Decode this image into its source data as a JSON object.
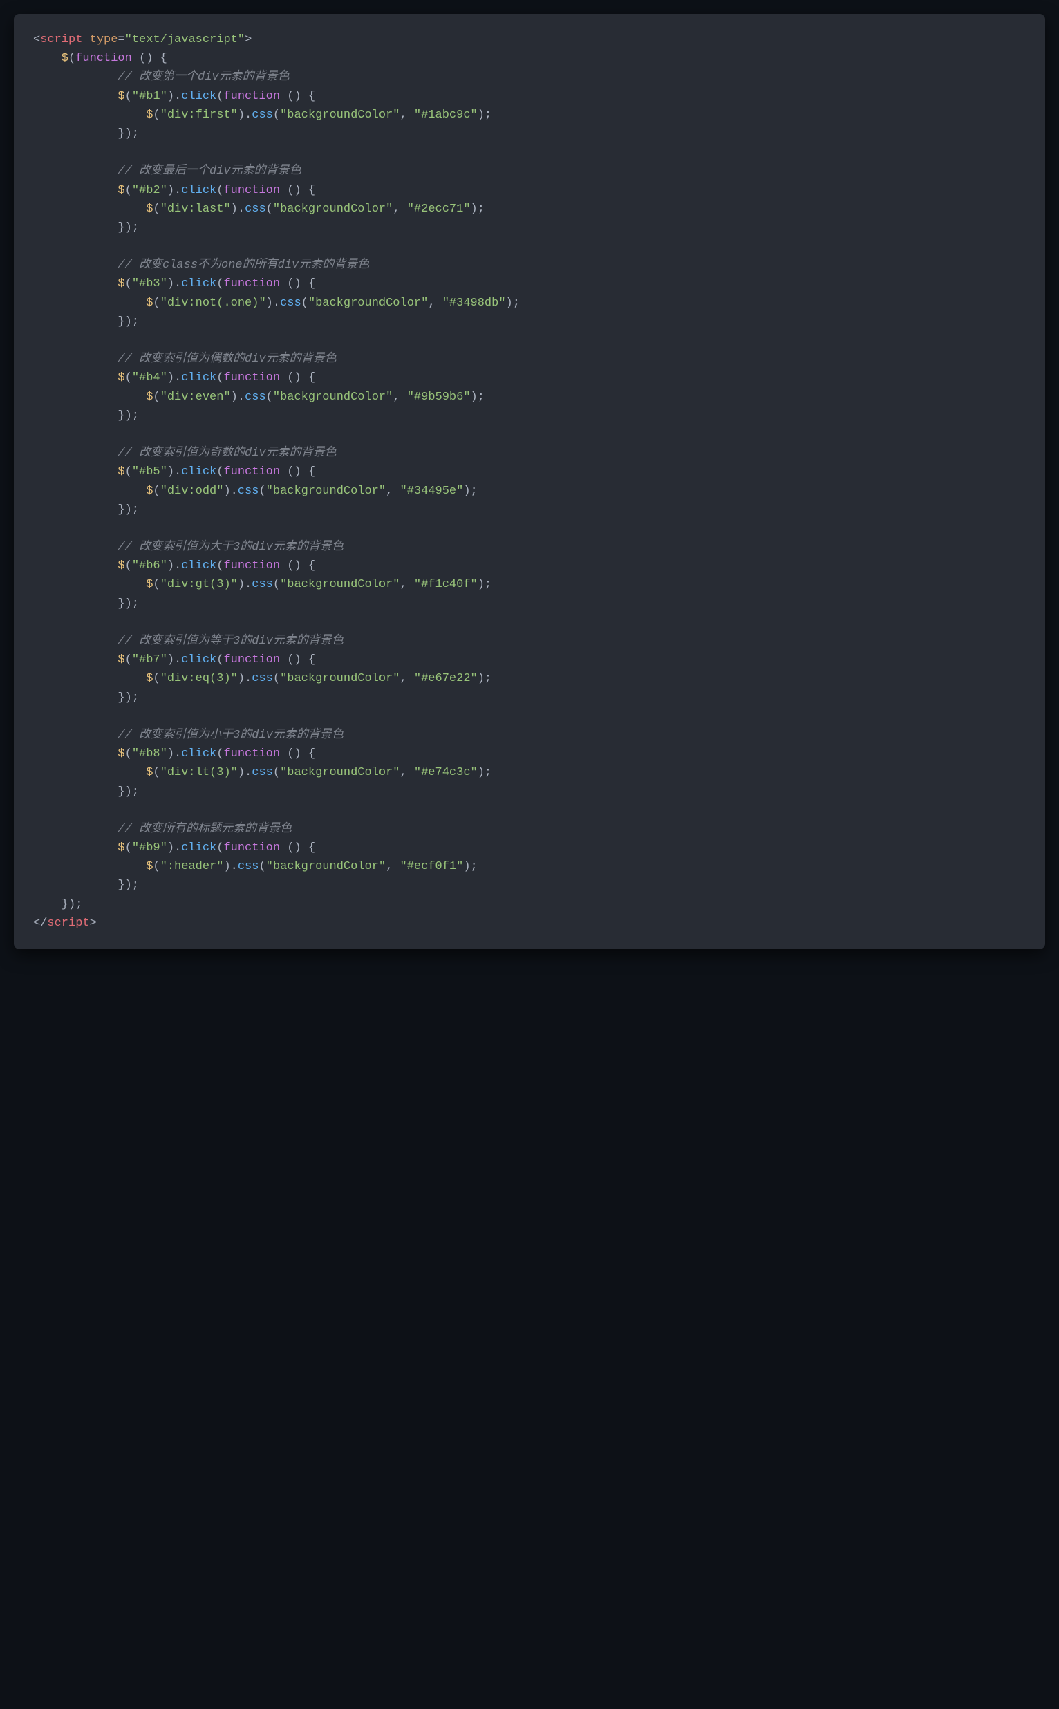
{
  "code": {
    "open_tag": {
      "lt": "<",
      "name": "script",
      "attr": "type",
      "eq": "=",
      "val": "\"text/javascript\"",
      "gt": ">"
    },
    "fn_open": {
      "dollar": "$",
      "lp": "(",
      "kw": "function",
      "sp": " ",
      "lp2": "(",
      "rp2": ")",
      "sp2": " ",
      "lb": "{"
    },
    "blocks": [
      {
        "comment": "// 改变第一个div元素的背景色",
        "id": "\"#b1\"",
        "sel": "\"div:first\"",
        "color": "\"#1abc9c\""
      },
      {
        "comment": "// 改变最后一个div元素的背景色",
        "id": "\"#b2\"",
        "sel": "\"div:last\"",
        "color": "\"#2ecc71\""
      },
      {
        "comment": "// 改变class不为one的所有div元素的背景色",
        "id": "\"#b3\"",
        "sel": "\"div:not(.one)\"",
        "color": "\"#3498db\""
      },
      {
        "comment": "// 改变索引值为偶数的div元素的背景色",
        "id": "\"#b4\"",
        "sel": "\"div:even\"",
        "color": "\"#9b59b6\""
      },
      {
        "comment": "// 改变索引值为奇数的div元素的背景色",
        "id": "\"#b5\"",
        "sel": "\"div:odd\"",
        "color": "\"#34495e\""
      },
      {
        "comment": "// 改变索引值为大于3的div元素的背景色",
        "id": "\"#b6\"",
        "sel": "\"div:gt(3)\"",
        "color": "\"#f1c40f\""
      },
      {
        "comment": "// 改变索引值为等于3的div元素的背景色",
        "id": "\"#b7\"",
        "sel": "\"div:eq(3)\"",
        "color": "\"#e67e22\""
      },
      {
        "comment": "// 改变索引值为小于3的div元素的背景色",
        "id": "\"#b8\"",
        "sel": "\"div:lt(3)\"",
        "color": "\"#e74c3c\""
      },
      {
        "comment": "// 改变所有的标题元素的背景色",
        "id": "\"#b9\"",
        "sel": "\":header\"",
        "color": "\"#ecf0f1\""
      }
    ],
    "click_str": "click",
    "css_str": "css",
    "bg_str": "\"backgroundColor\"",
    "fn_close": "});",
    "close_tag": {
      "lt": "</",
      "name": "script",
      "gt": ">"
    }
  }
}
